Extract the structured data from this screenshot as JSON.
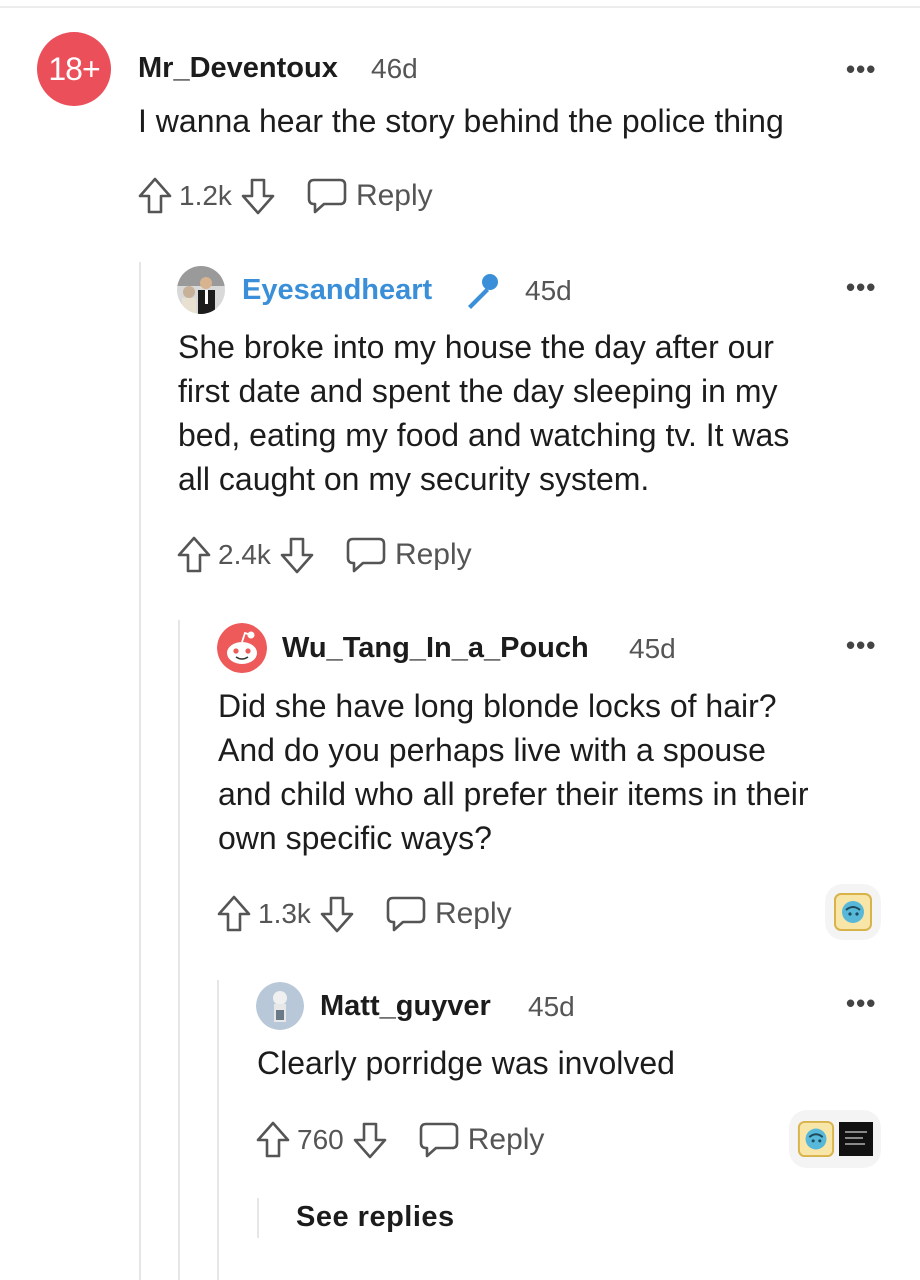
{
  "comments": [
    {
      "avatar_text": "18+",
      "username": "Mr_Deventoux",
      "age": "46d",
      "text": "I wanna hear the story behind the police thing",
      "upvotes": "1.2k",
      "reply_label": "Reply"
    },
    {
      "username": "Eyesandheart",
      "age": "45d",
      "text_lines": [
        "She broke into my house the day after our",
        "first date and spent the day sleeping in my",
        "bed, eating my food and watching tv. It was",
        "all caught on my security system."
      ],
      "upvotes": "2.4k",
      "reply_label": "Reply"
    },
    {
      "username": "Wu_Tang_In_a_Pouch",
      "age": "45d",
      "text_lines": [
        "Did she have long blonde locks of hair?",
        "And do you perhaps live with a spouse",
        "and child who all prefer their items in their",
        "own specific ways?"
      ],
      "upvotes": "1.3k",
      "reply_label": "Reply"
    },
    {
      "username": "Matt_guyver",
      "age": "45d",
      "text": "Clearly porridge was involved",
      "upvotes": "760",
      "reply_label": "Reply"
    }
  ],
  "more_label": "•••",
  "see_replies": "See replies",
  "colors": {
    "accent_blue": "#3a8fd8",
    "nsfw_red": "#ea4f5a"
  },
  "icons": [
    "upvote-icon",
    "downvote-icon",
    "comment-icon",
    "microphone-icon",
    "more-icon"
  ]
}
